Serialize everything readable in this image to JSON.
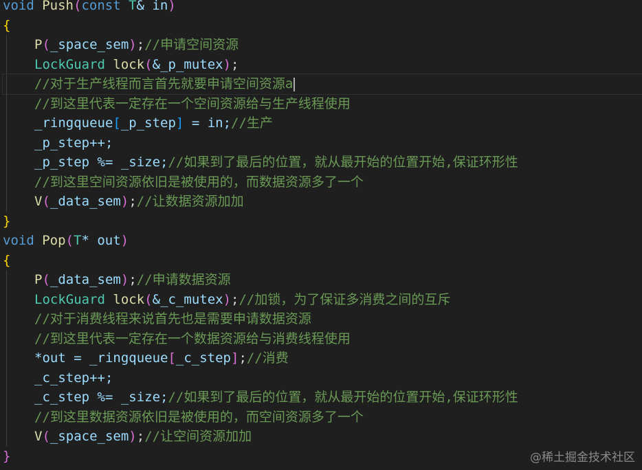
{
  "editor": {
    "push_sig": {
      "kw": "void",
      "fn": "Push",
      "open": "(",
      "kw2": "const",
      "ty": "T",
      "rest": "& in",
      "close": ")"
    },
    "push_open_brace": "{",
    "push_l1": {
      "fn": "P",
      "open": "(",
      "arg": "_space_sem",
      "close": ")",
      "semi": ";",
      "comment": "//申请空间资源"
    },
    "push_l2": {
      "ty": "LockGuard",
      "fn": "lock",
      "open": "(",
      "arg": "&_p_mutex",
      "close": ")",
      "semi": ";"
    },
    "push_l3": {
      "comment": "//对于生产线程而言首先就要申请空间资源a"
    },
    "push_l4": {
      "comment": "//到这里代表一定存在一个空间资源给与生产线程使用"
    },
    "push_l5": {
      "var": "_ringqueue",
      "open": "[",
      "idx": "_p_step",
      "close": "]",
      "rest": " = in;",
      "comment": "//生产"
    },
    "push_l6": {
      "code": "_p_step++;"
    },
    "push_l7": {
      "code": "_p_step %= _size;",
      "comment": "//如果到了最后的位置，就从最开始的位置开始,保证环形性"
    },
    "push_l8": {
      "comment": "//到这里空间资源依旧是被使用的，而数据资源多了一个"
    },
    "push_l9": {
      "fn": "V",
      "open": "(",
      "arg": "_data_sem",
      "close": ")",
      "semi": ";",
      "comment": "//让数据资源加加"
    },
    "push_close_brace": "}",
    "pop_sig": {
      "kw": "void",
      "fn": "Pop",
      "open": "(",
      "ty": "T",
      "rest": "* out",
      "close": ")"
    },
    "pop_open_brace": "{",
    "pop_l1": {
      "fn": "P",
      "open": "(",
      "arg": "_data_sem",
      "close": ")",
      "semi": ";",
      "comment": "//申请数据资源"
    },
    "pop_l2": {
      "ty": "LockGuard",
      "fn": "lock",
      "open": "(",
      "arg": "&_c_mutex",
      "close": ")",
      "semi": ";",
      "comment": "//加锁，为了保证多消费之间的互斥"
    },
    "pop_l3": {
      "comment": "//对于消费线程来说首先也是需要申请数据资源"
    },
    "pop_l4": {
      "comment": "//到这里代表一定存在一个数据资源给与消费线程使用"
    },
    "pop_l5": {
      "pre": "*out = ",
      "var": "_ringqueue",
      "open": "[",
      "idx": "_c_step",
      "close": "]",
      "semi": ";",
      "comment": "//消费"
    },
    "pop_l6": {
      "code": "_c_step++;"
    },
    "pop_l7": {
      "code": "_c_step %= _size;",
      "comment": "//如果到了最后的位置，就从最开始的位置开始,保证环形性"
    },
    "pop_l8": {
      "comment": "//到这里数据资源依旧是被使用的，而空间资源多了一个"
    },
    "pop_l9": {
      "fn": "V",
      "open": "(",
      "arg": "_space_sem",
      "close": ")",
      "semi": ";",
      "comment": "//让空间资源加加"
    },
    "pop_close_brace": "}"
  },
  "watermark": "@稀土掘金技术社区",
  "colors": {
    "background": "#1f1f1f",
    "keyword": "#569cd6",
    "function": "#dcdcaa",
    "type": "#4ec9b0",
    "variable": "#9cdcfe",
    "comment": "#6a9955",
    "bracket_1": "#ffd700",
    "bracket_2": "#da70d6",
    "bracket_3": "#179fff"
  }
}
